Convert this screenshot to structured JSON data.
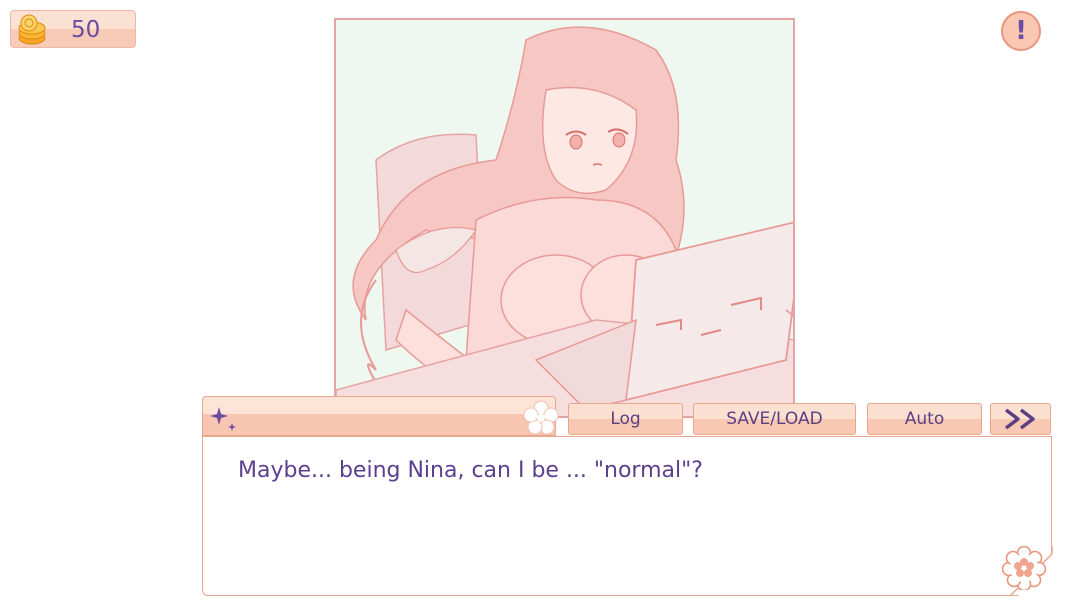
{
  "hud": {
    "coins": "50",
    "coin_icon": "coin-stack-icon",
    "alert_icon": "exclamation-icon",
    "alert_symbol": "!"
  },
  "dialogue": {
    "speaker": "",
    "text": "Maybe... being Nina, can I be ... \"normal\"?"
  },
  "controls": {
    "log_label": "Log",
    "save_load_label": "SAVE/LOAD",
    "auto_label": "Auto",
    "skip_icon": "fast-forward-icon"
  },
  "theme": {
    "accent": "#f8c6b0",
    "border": "#e8a68d",
    "text": "#5c3f8e",
    "illustration_bg": "#eef7f0"
  }
}
